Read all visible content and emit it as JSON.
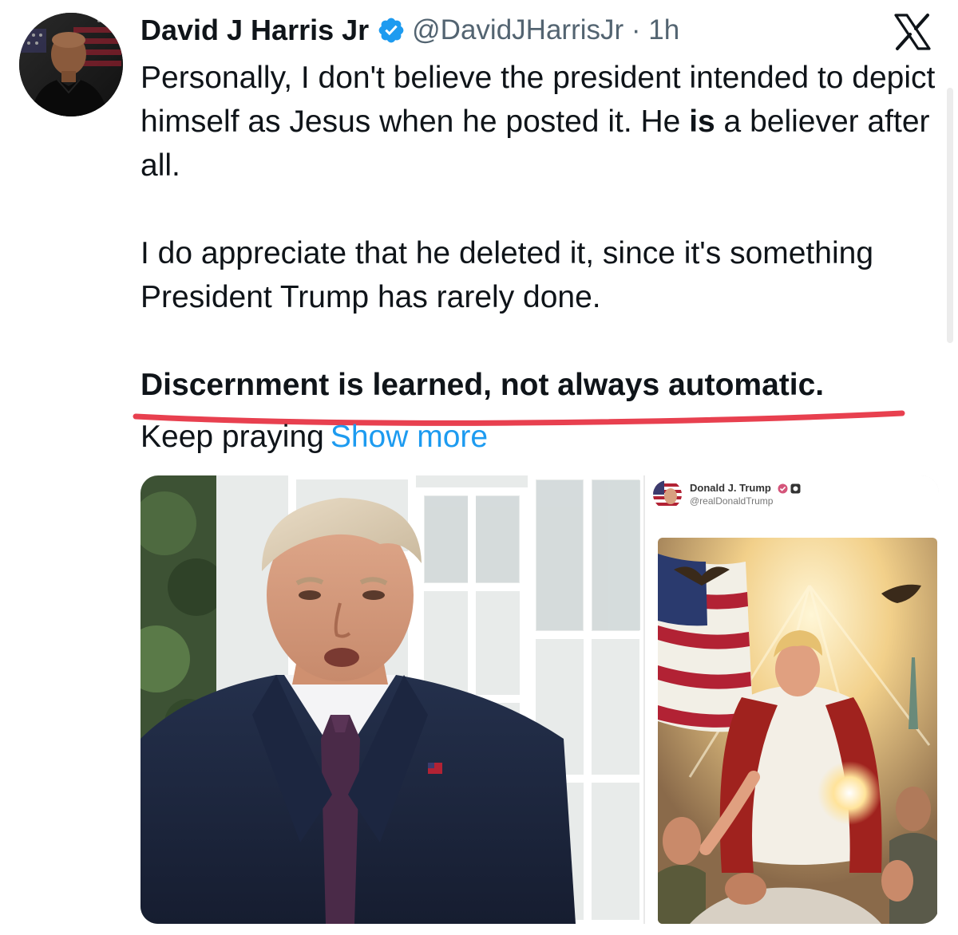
{
  "tweet": {
    "author": {
      "display_name": "David J Harris Jr",
      "handle_and_time": "@DavidJHarrisJr · 1h",
      "verified": true,
      "avatar_icon": "avatar-photo"
    },
    "platform_logo": "x-logo-icon",
    "text": {
      "para1_a": "Personally, I don't believe the president intended to depict himself as Jesus when he posted it. He ",
      "para1_bold": "is",
      "para1_b": " a believer after all.",
      "para2": "I do appreciate that he deleted it, since it's something President Trump has rarely done.",
      "para3": "Discernment is learned, not always automatic.",
      "keep_praying": "Keep praying",
      "show_more": "Show more"
    },
    "highlight_color": "#e8404f",
    "media": {
      "right_panel": {
        "name": "Donald J. Trump",
        "handle": "@realDonaldTrump"
      }
    },
    "colors": {
      "text": "#0f1419",
      "secondary": "#536471",
      "link": "#1d9bf0",
      "verified": "#1d9bf0"
    }
  }
}
